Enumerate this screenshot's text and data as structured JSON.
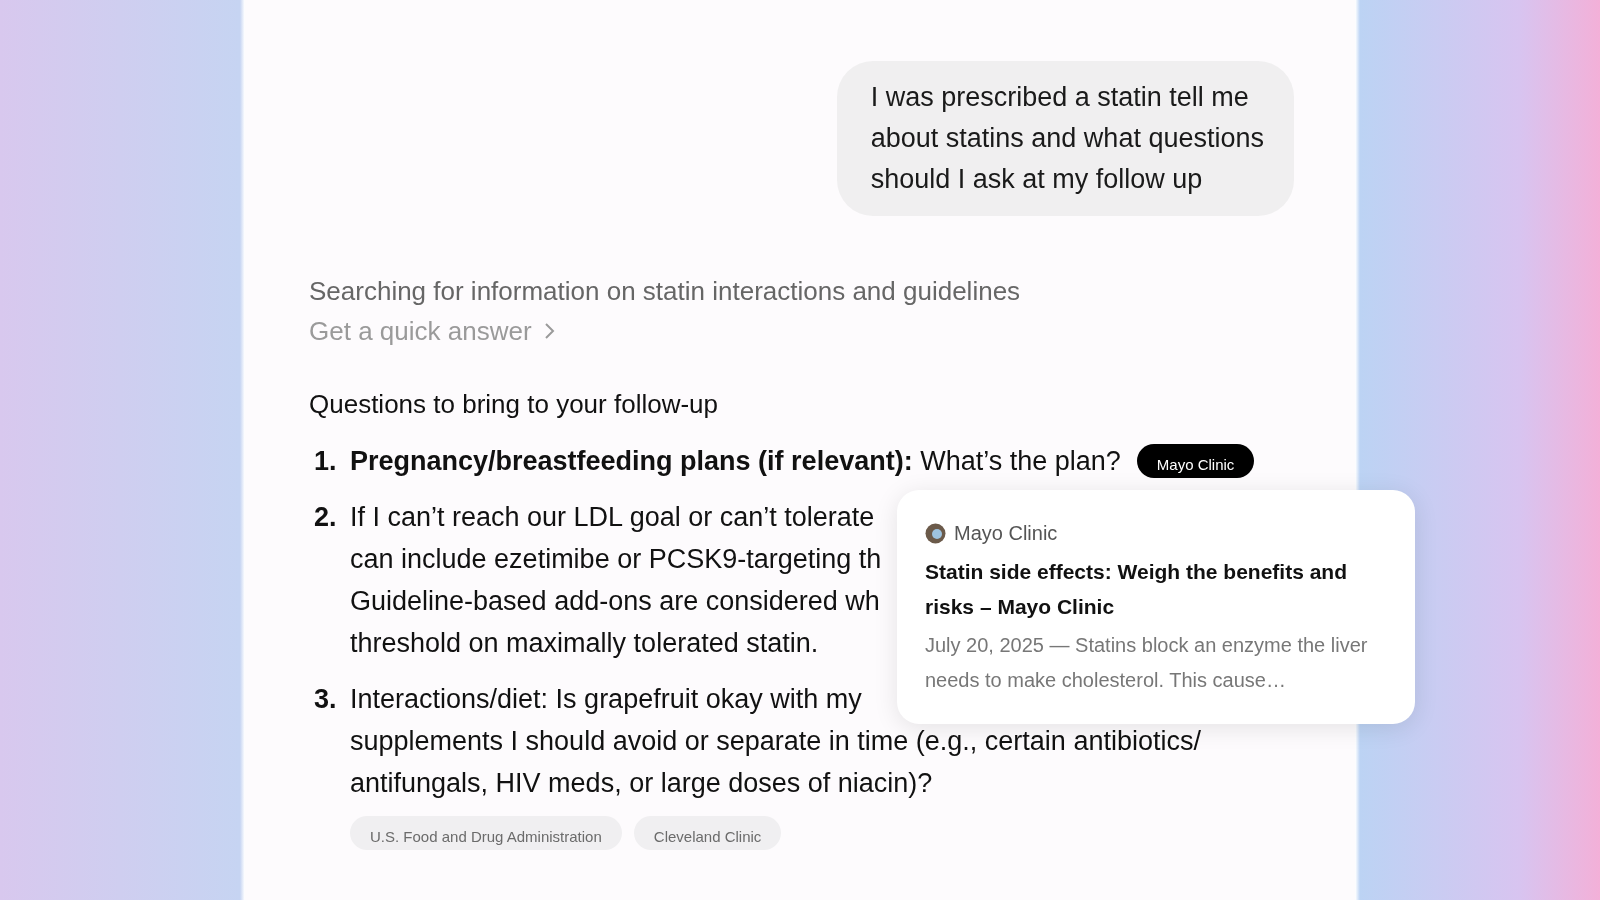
{
  "user_message": {
    "lines": [
      "I was prescribed a statin tell me",
      "about statins and what questions",
      "should I ask at my follow up"
    ]
  },
  "status": {
    "text": "Searching for information on statin interactions and guidelines",
    "link": "Get a quick answer"
  },
  "heading": "Questions to bring to your follow-up",
  "questions": [
    {
      "number": "1.",
      "lines": [
        "**Pregnancy/breastfeeding plans (if relevant):** What’s the plan?"
      ],
      "source": {
        "label": "Mayo Clinic",
        "selected": true
      }
    },
    {
      "number": "2.",
      "lines": [
        "If I can’t reach our LDL goal or can’t tolerate",
        "can include ezetimibe or PCSK9-targeting th",
        "Guideline-based add-ons are considered wh",
        "threshold on maximally tolerated statin."
      ]
    },
    {
      "number": "3.",
      "lines": [
        "Interactions/diet: Is grapefruit okay with my",
        "supplements I should avoid or separate in time (e.g., certain antibiotics/",
        "antifungals, HIV meds, or large doses of niacin)?"
      ],
      "chips": [
        {
          "label": "U.S. Food and Drug Administration",
          "selected": false
        },
        {
          "label": "Cleveland Clinic",
          "selected": false
        }
      ]
    }
  ],
  "source_card": {
    "site": "Mayo Clinic",
    "title": "Statin side effects: Weigh the benefits and risks – Mayo Clinic",
    "snippet": "July 20, 2025 — Statins block an enzyme the liver needs to make cholesterol. This cause…"
  }
}
